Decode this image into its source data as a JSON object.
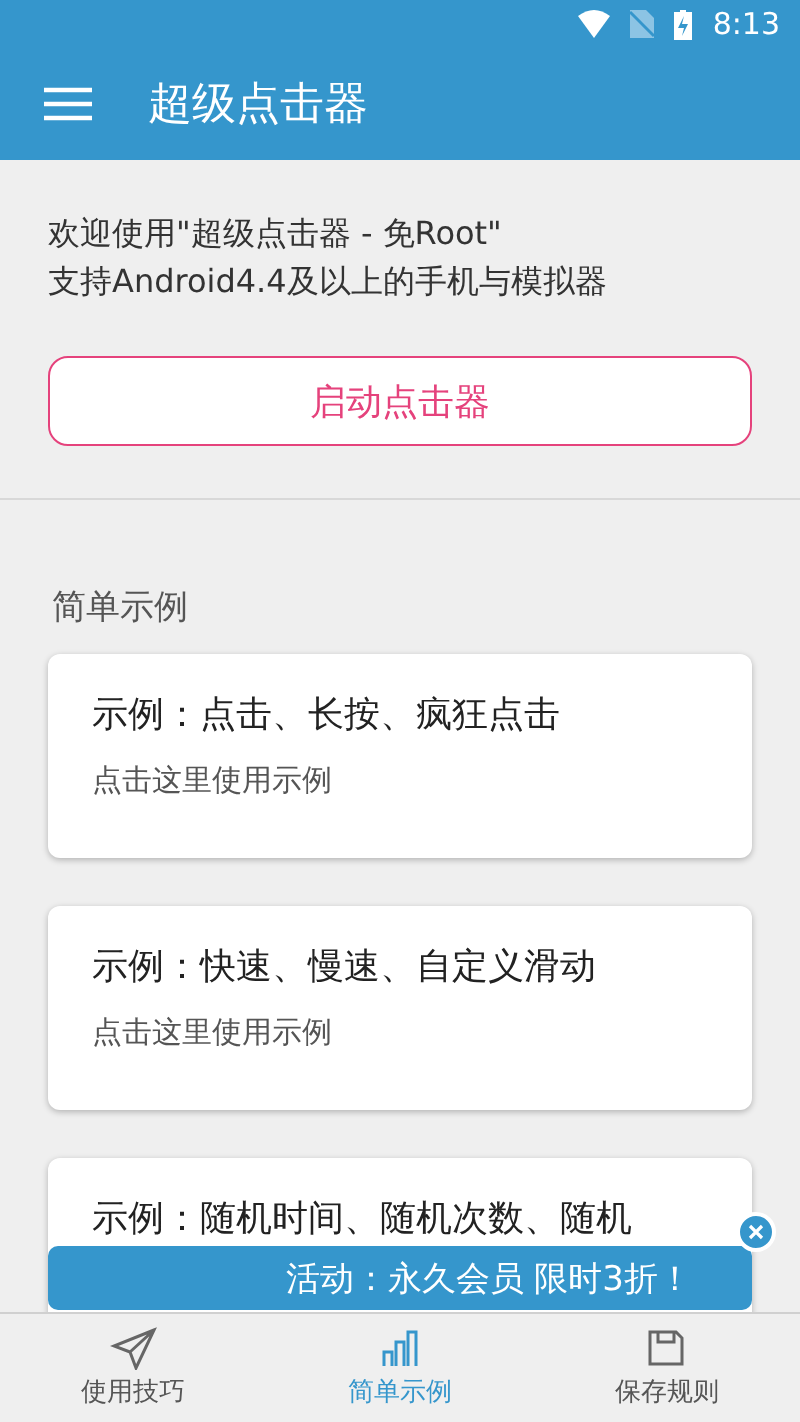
{
  "status_bar": {
    "time": "8:13"
  },
  "app_bar": {
    "title": "超级点击器"
  },
  "intro": [
    "欢迎使用\"超级点击器 - 免Root\"",
    "支持Android4.4及以上的手机与模拟器"
  ],
  "start_button": "启动点击器",
  "section_title": "简单示例",
  "examples": [
    {
      "title": "示例：点击、长按、疯狂点击",
      "subtitle": "点击这里使用示例"
    },
    {
      "title": "示例：快速、慢速、自定义滑动",
      "subtitle": "点击这里使用示例"
    },
    {
      "title": "示例：随机时间、随机次数、随机"
    }
  ],
  "promo_banner": {
    "text": "活动：永久会员 限时3折！"
  },
  "bottom_nav": [
    {
      "label": "使用技巧",
      "selected": false
    },
    {
      "label": "简单示例",
      "selected": true
    },
    {
      "label": "保存规则",
      "selected": false
    }
  ]
}
